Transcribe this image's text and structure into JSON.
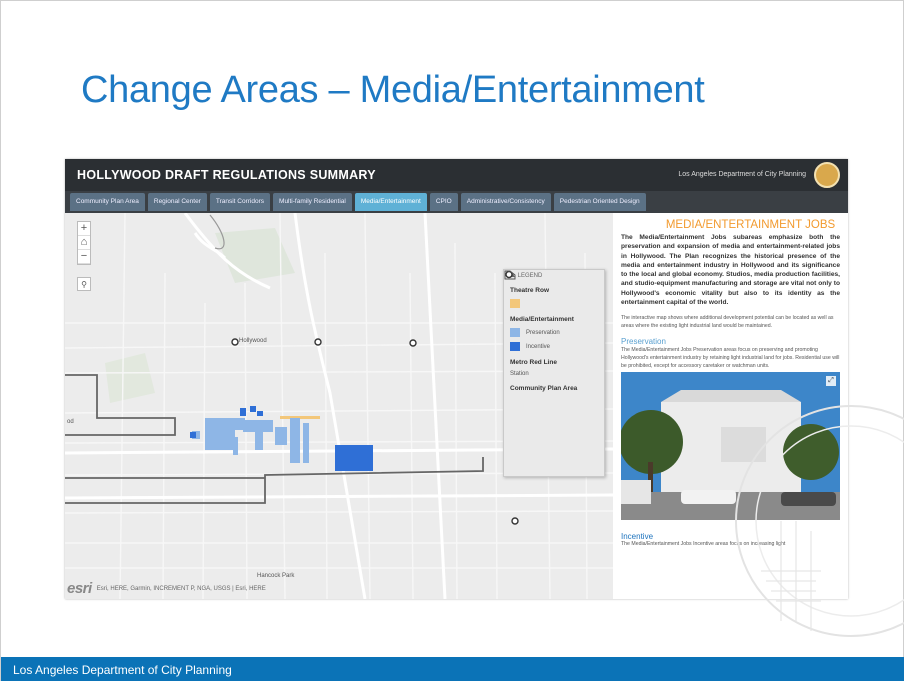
{
  "slide": {
    "title": "Change Areas – Media/Entertainment",
    "footer": "Los Angeles Department of City Planning"
  },
  "app": {
    "title": "HOLLYWOOD DRAFT REGULATIONS SUMMARY",
    "department": "Los Angeles Department of City Planning",
    "tabs": [
      {
        "label": "Community Plan Area",
        "active": false
      },
      {
        "label": "Regional Center",
        "active": false
      },
      {
        "label": "Transit Corridors",
        "active": false
      },
      {
        "label": "Multi-family Residential",
        "active": false
      },
      {
        "label": "Media/Entertainment",
        "active": true
      },
      {
        "label": "CPIO",
        "active": false
      },
      {
        "label": "Administrative/Consistency",
        "active": false
      },
      {
        "label": "Pedestrian Oriented Design",
        "active": false
      }
    ]
  },
  "map": {
    "zoom_in": "+",
    "home": "⌂",
    "zoom_out": "−",
    "search": "⚲",
    "esri": "esri",
    "attribution": "Esri, HERE, Garmin, INCREMENT P, NGA, USGS | Esri, HERE",
    "label_hollywood": "Hollywood",
    "label_od": "od",
    "label_hancock": "Hancock Park"
  },
  "legend": {
    "toggle": "▲ LEGEND",
    "sections": [
      {
        "title": "Theatre Row",
        "items": [
          {
            "label": "",
            "color": "#f3c77a",
            "icon": "theatre-swatch"
          }
        ]
      },
      {
        "title": "Media/Entertainment",
        "items": [
          {
            "label": "Preservation",
            "color": "#8eb6e6",
            "icon": "preservation-swatch"
          },
          {
            "label": "Incentive",
            "color": "#2f6fd6",
            "icon": "incentive-swatch"
          }
        ]
      },
      {
        "title": "Metro Red Line",
        "items": [
          {
            "label": "Station",
            "color": "#333333",
            "icon": "station-icon"
          }
        ]
      },
      {
        "title": "Community Plan Area",
        "items": [
          {
            "label": "",
            "color": "#666666",
            "icon": "plan-area-icon"
          }
        ]
      }
    ]
  },
  "info": {
    "heading": "MEDIA/ENTERTAINMENT JOBS",
    "paragraph1": "The Media/Entertainment Jobs subareas emphasize both the preservation and expansion of media and entertainment-related jobs in Hollywood. The Plan recognizes the historical presence of the media and entertainment industry in Hollywood and its significance to the local and global economy. Studios, media production facilities, and studio-equipment manufacturing and storage are vital not only to Hollywood's economic vitality but also to its identity as the entertainment capital of the world.",
    "paragraph2": "The interactive map shows where additional development potential can be located as well as areas where the existing light industrial land would be maintained.",
    "sub1": "Preservation",
    "paragraph3": "The Media/Entertainment Jobs Preservation areas focus on preserving and promoting Hollywood's entertainment industry by retaining light industrial land for jobs. Residential use will be prohibited, except for accessory caretaker or watchman units.",
    "photo_expand": "⤢",
    "sub2": "Incentive",
    "paragraph4": "The Media/Entertainment Jobs Incentive areas focus on increasing light"
  },
  "colors": {
    "title_blue": "#1f7ac4",
    "footer_blue": "#0b73b7",
    "header_dark": "#2b2f33",
    "tab_active": "#5fb1d6",
    "heading_orange": "#f29a2e",
    "preservation": "#8eb6e6",
    "incentive": "#2f6fd6"
  }
}
